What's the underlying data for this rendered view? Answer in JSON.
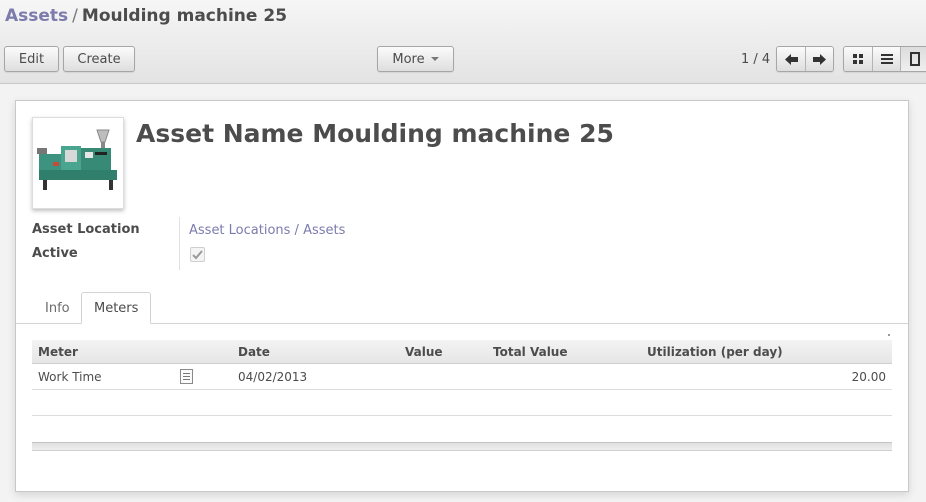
{
  "breadcrumb": {
    "parent": "Assets",
    "separator": "/",
    "current": "Moulding machine 25"
  },
  "toolbar": {
    "edit_label": "Edit",
    "create_label": "Create",
    "more_label": "More"
  },
  "pager": {
    "text": "1 / 4"
  },
  "view_modes": [
    "kanban",
    "list",
    "form"
  ],
  "active_view": "form",
  "record": {
    "title": "Asset Name Moulding machine 25",
    "fields": {
      "location_label": "Asset Location",
      "location_value": "Asset Locations / Assets",
      "active_label": "Active",
      "active_value": true
    }
  },
  "tabs": [
    {
      "label": "Info",
      "active": false
    },
    {
      "label": "Meters",
      "active": true
    }
  ],
  "meters_table": {
    "columns": [
      "Meter",
      "Date",
      "Value",
      "Total Value",
      "Utilization (per day)"
    ],
    "rows": [
      {
        "meter": "Work Time",
        "date": "04/02/2013",
        "value": "",
        "total_value": "",
        "utilization": "20.00"
      }
    ]
  },
  "colors": {
    "link": "#7c7bad",
    "text": "#4c4c4c"
  }
}
